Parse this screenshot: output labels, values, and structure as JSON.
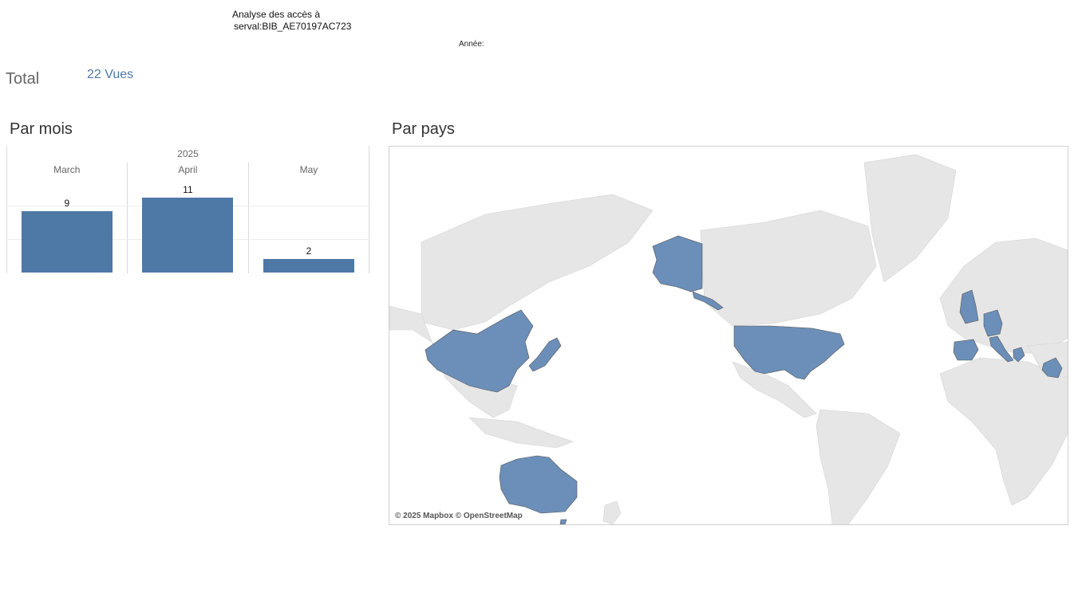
{
  "header": {
    "title_line1": "Analyse des accès à",
    "title_line2": "serval:BIB_AE70197AC723",
    "annee_label": "Année:"
  },
  "total": {
    "label": "Total",
    "value": "22 Vues"
  },
  "par_mois": {
    "title": "Par mois",
    "chart_data": {
      "type": "bar",
      "categories": [
        "March",
        "April",
        "May"
      ],
      "values": [
        9,
        11,
        2
      ],
      "group_label": "2025",
      "ylim": [
        0,
        11
      ],
      "color": "#4e79a7"
    }
  },
  "par_pays": {
    "title": "Par pays",
    "attribution": "© 2025 Mapbox © OpenStreetMap",
    "highlight_color": "#6b8fb8",
    "land_color": "#e6e6e6",
    "ocean_color": "#ffffff",
    "highlighted_countries": [
      "United States",
      "China",
      "Japan",
      "Australia",
      "United Kingdom",
      "Germany",
      "Italy",
      "Spain",
      "Greece",
      "Iraq"
    ]
  }
}
